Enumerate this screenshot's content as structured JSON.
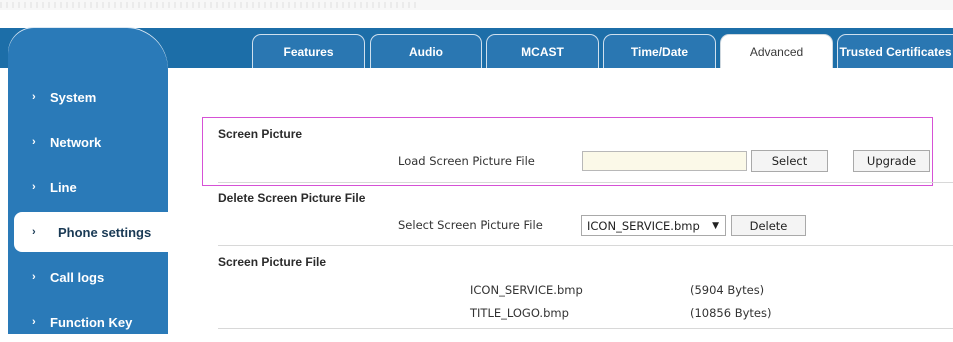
{
  "sidebar": {
    "items": [
      {
        "label": "System"
      },
      {
        "label": "Network"
      },
      {
        "label": "Line"
      },
      {
        "label": "Phone settings"
      },
      {
        "label": "Call logs"
      },
      {
        "label": "Function Key"
      }
    ],
    "active": "Phone settings",
    "chevron": "›"
  },
  "tabs": [
    {
      "label": "Features"
    },
    {
      "label": "Audio"
    },
    {
      "label": "MCAST"
    },
    {
      "label": "Time/Date"
    },
    {
      "label": "Advanced"
    },
    {
      "label": "Trusted Certificates"
    }
  ],
  "active_tab": "Advanced",
  "screen_picture": {
    "title": "Screen Picture",
    "load_label": "Load Screen Picture File",
    "file_value": "",
    "select_button": "Select",
    "upgrade_button": "Upgrade"
  },
  "delete_section": {
    "title": "Delete Screen Picture File",
    "select_label": "Select Screen Picture File",
    "selected_file": "ICON_SERVICE.bmp",
    "delete_button": "Delete"
  },
  "file_section": {
    "title": "Screen Picture File",
    "files": [
      {
        "name": "ICON_SERVICE.bmp",
        "size": "(5904 Bytes)"
      },
      {
        "name": "TITLE_LOGO.bmp",
        "size": "(10856 Bytes)"
      }
    ]
  },
  "colors": {
    "sidebar_bg": "#2a7ab8",
    "tab_bg": "#2a77b2",
    "highlight_border": "#d651d6",
    "file_input_bg": "#fbf9e8"
  },
  "icons": {
    "chevron": "chevron-right-icon",
    "select_arrow": "caret-down-icon"
  }
}
